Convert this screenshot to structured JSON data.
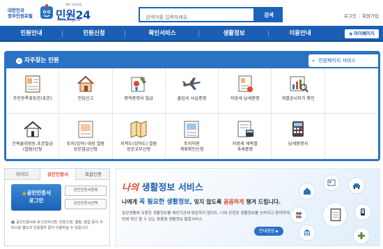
{
  "header": {
    "logo_small": "대한민국\n정부민원포털",
    "logo_title": "민원24",
    "logo_url": "minwon.go.kr",
    "logo_tag": "행복 자연민원",
    "search_placeholder": "검색어를 입력하세요",
    "search_button": "검색",
    "login_link": "로그인",
    "signup_link": "회원가입"
  },
  "nav": {
    "items": [
      "민원안내",
      "민원신청",
      "확인서비스",
      "생활정보",
      "이용안내"
    ],
    "mypage": "마이페이지"
  },
  "quick": {
    "title": "자주찾는 민원",
    "package_tab": "민원패키지 서비스",
    "services": [
      {
        "label": "주민등록표등본(초본)",
        "icon": "resident-register-icon"
      },
      {
        "label": "전입신고",
        "icon": "house-move-in-icon"
      },
      {
        "label": "병적증명서 발급",
        "icon": "military-record-icon"
      },
      {
        "label": "출입국 사실증명",
        "icon": "airplane-icon"
      },
      {
        "label": "지방세 납세증명",
        "icon": "tax-certificate-icon"
      },
      {
        "label": "개별공시지가 확인",
        "icon": "land-price-icon"
      },
      {
        "label": "건축물대장등.초본발급\n(열람)신청",
        "icon": "building-register-icon"
      },
      {
        "label": "토지(임야) 대장 열람\n등본발급신청",
        "icon": "land-register-icon"
      },
      {
        "label": "지적도(임야도) 열람\n등본교부신청",
        "icon": "cadastral-map-icon"
      },
      {
        "label": "토지이용\n계획확인신청",
        "icon": "land-use-plan-icon"
      },
      {
        "label": "지방세 세목별\n과세증명",
        "icon": "tax-item-icon"
      },
      {
        "label": "납세증명서",
        "icon": "calculator-icon"
      }
    ]
  },
  "login": {
    "tabs": [
      "아이디",
      "공인인증서",
      "복합인증"
    ],
    "cert_button": "공인인증서\n로그인",
    "register_cert": "공인인증서등록",
    "select_cert": "공인인증서선택",
    "note": "공인인증서로 로그인하시면, 민원신청, 열람, 발급 등의 서비스를 별도의 인증절차 없이 이용하실 수 있습니다."
  },
  "life": {
    "title_prefix": "나의",
    "title": "생활정보 서비스",
    "subtitle_a": "나에게 ",
    "subtitle_b": "꼭 필요한 생활정보,",
    "subtitle_c": " 잊지 않도록 ",
    "subtitle_d": "꼼꼼하게",
    "subtitle_e": " 챙겨 드립니다.",
    "desc": "일상생활에 유용한 생활정보를 해당기관에 방문하지 않아도, 나와 관련된 생활정보를 신속하고 편리하게 한번에 확인 할 수 있는 맞춤형 생활정보 통합서비스",
    "guide_button": "안내영상"
  },
  "colors": {
    "primary": "#1b5fb4",
    "accent": "#e2462d",
    "quick_border": "#2a72c4"
  }
}
